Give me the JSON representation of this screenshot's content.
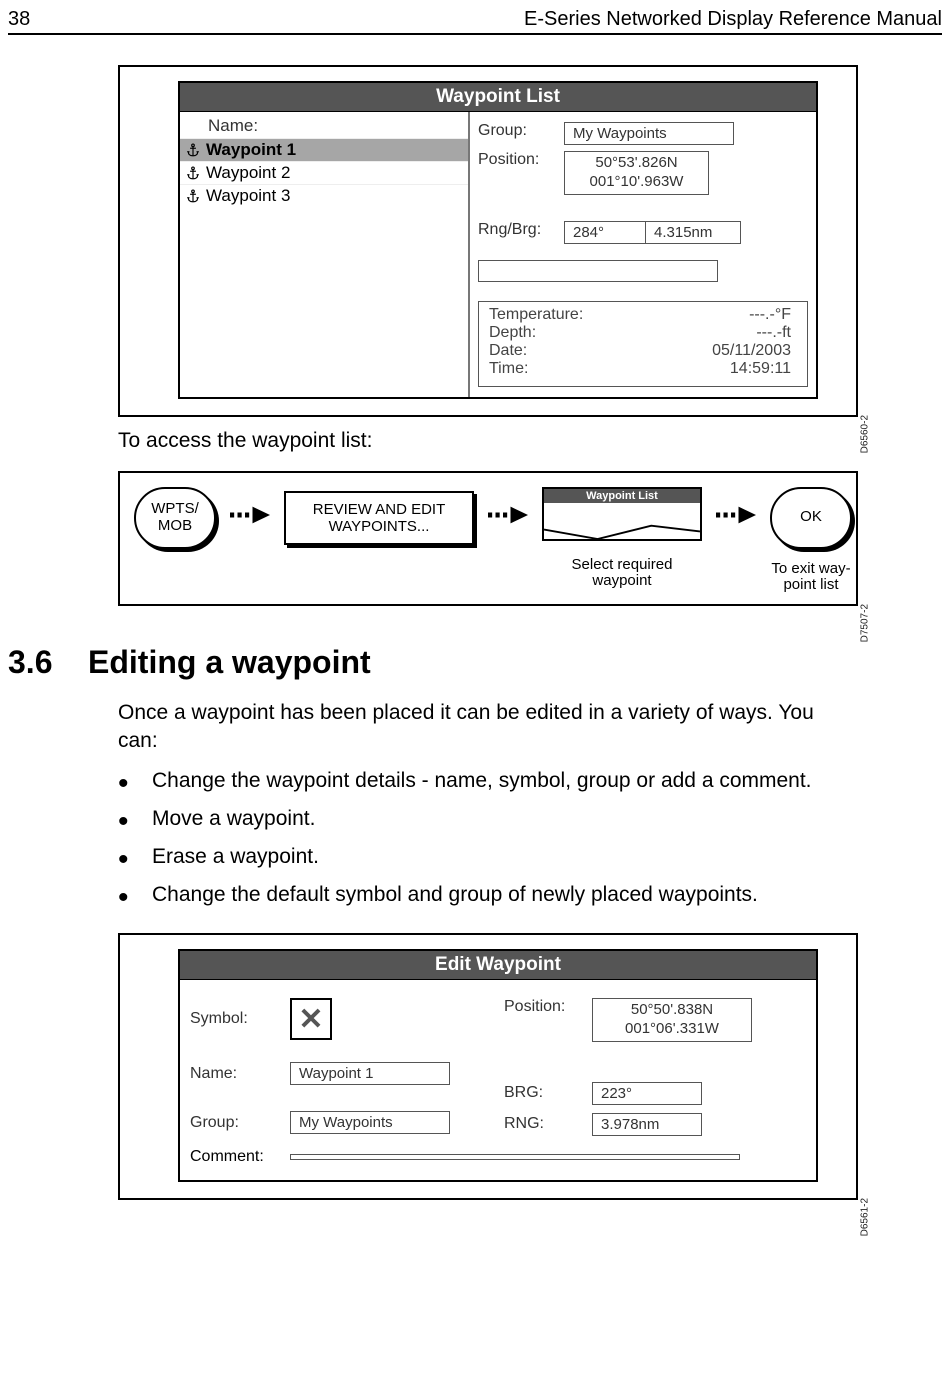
{
  "header": {
    "page_number": "38",
    "doc_title": "E-Series Networked Display Reference Manual"
  },
  "waypoint_list": {
    "title": "Waypoint List",
    "name_head": "Name:",
    "rows": [
      {
        "name": "Waypoint 1",
        "selected": true
      },
      {
        "name": "Waypoint 2",
        "selected": false
      },
      {
        "name": "Waypoint 3",
        "selected": false
      }
    ],
    "group_label": "Group:",
    "group_value": "My Waypoints",
    "position_label": "Position:",
    "position_line1": "50°53'.826N",
    "position_line2": "001°10'.963W",
    "rngbrg_label": "Rng/Brg:",
    "bearing": "284°",
    "range": "4.315nm",
    "temperature_label": "Temperature:",
    "temperature_value": "---.-°F",
    "depth_label": "Depth:",
    "depth_value": "---.-ft",
    "date_label": "Date:",
    "date_value": "05/11/2003",
    "time_label": "Time:",
    "time_value": "14:59:11",
    "fig_code": "D6560-2"
  },
  "access_text": "To access the waypoint list:",
  "flow": {
    "btn1": "WPTS/\nMOB",
    "btn2": "REVIEW AND EDIT WAYPOINTS...",
    "mini_title": "Waypoint List",
    "caption_select": "Select required waypoint",
    "btn3": "OK",
    "caption_ok": "To exit way-\npoint list",
    "fig_code": "D7507-2"
  },
  "section": {
    "num": "3.6",
    "title": "Editing a waypoint",
    "intro": "Once a waypoint has been placed it can be edited in a variety of ways. You can:",
    "bullets": [
      "Change the waypoint details - name, symbol, group or add a comment.",
      "Move a waypoint.",
      "Erase a waypoint.",
      "Change the default symbol and group of newly placed waypoints."
    ]
  },
  "edit_wp": {
    "title": "Edit Waypoint",
    "symbol_label": "Symbol:",
    "name_label": "Name:",
    "name_value": "Waypoint 1",
    "group_label": "Group:",
    "group_value": "My Waypoints",
    "comment_label": "Comment:",
    "position_label": "Position:",
    "position_line1": "50°50'.838N",
    "position_line2": "001°06'.331W",
    "brg_label": "BRG:",
    "brg_value": "223°",
    "rng_label": "RNG:",
    "rng_value": "3.978nm",
    "fig_code": "D6561-2"
  }
}
